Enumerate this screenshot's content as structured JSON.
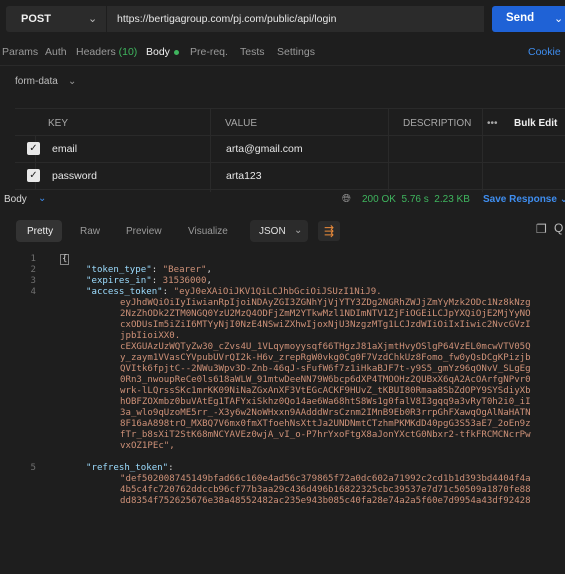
{
  "request": {
    "method": "POST",
    "url": "https://bertigagroup.com/pj.com/public/api/login",
    "send_label": "Send"
  },
  "request_tabs": {
    "params": "Params",
    "auth": "Auth",
    "headers": "Headers",
    "headers_count": "(10)",
    "body": "Body",
    "prereq": "Pre-req.",
    "tests": "Tests",
    "settings": "Settings",
    "cookies": "Cookie"
  },
  "body_mode": "form-data",
  "params_table": {
    "headers": {
      "key": "KEY",
      "value": "VALUE",
      "description": "DESCRIPTION",
      "more": "•••",
      "bulk_edit": "Bulk Edit"
    },
    "rows": [
      {
        "key": "email",
        "value": "arta@gmail.com"
      },
      {
        "key": "password",
        "value": "arta123"
      }
    ]
  },
  "response": {
    "body_tab": "Body",
    "status": "200 OK",
    "time": "5.76 s",
    "size": "2.23 KB",
    "save_label": "Save Response",
    "view_tabs": {
      "pretty": "Pretty",
      "raw": "Raw",
      "preview": "Preview",
      "visualize": "Visualize"
    },
    "format": "JSON"
  },
  "code": {
    "l1": "{",
    "l2_key": "\"token_type\"",
    "l2_val": "\"Bearer\"",
    "l3_key": "\"expires_in\"",
    "l3_val": "31536000",
    "l4_key": "\"access_token\"",
    "l4_val": "\"eyJ0eXAiOiJKV1QiLCJhbGciOiJSUzI1NiJ9.",
    "access_cont": [
      "eyJhdWQiOiIyIiwianRpIjoiNDAyZGI3ZGNhYjVjYTY3ZDg2NGRhZWJjZmYyMzk2ODc1Nz8kNzg",
      "2NzZhODk2ZTM0NGQ0YzU2MzQ4ODFjZmM2YTkwMzl1NDImNTV1ZjFiOGEiLCJpYXQiOjE2MjYyNO",
      "cxODUsIm5iZiI6MTYyNjI0NzE4NSwiZXhwIjoxNjU3NzgzMTg1LCJzdWIiOiIxIiwic2NvcGVzI",
      "jpbIioiXX0.",
      "cEXGUAzUzWQTyZw30_cZvs4U_1VLqymoyysqf66THgzJ81aXjmtHvyOSlgP64VzEL0mcwVTV05Q",
      "y_zaym1VVasCYVpubUVrQI2k-H6v_zrepRgW0vkg0Cg0F7VzdChkUz8Fomo_fw0yQsDCgKPizjb",
      "QVItk6fpjtC--2NWu3Wpv3D-Znb-46qJ-sFufW6f7z1iHkaBJF7t-y9S5_gmYz96qONvV_SLgEg",
      "0Rn3_nwoupReCe0ls618aWLW_91mtwDeeNN79W6bcp6dXP4TMOOHz2QUBxX6qA2AcOArfgNPvr0",
      "wrk-lLQrssSKc1mrKK09NiNaZGxAnXF3VtEGcACKF9HUvZ_tKBUI80Rmaa8SbZdOPY9SYSdiyXb",
      "hOBFZOXmbz0buVAtEg1TAFYxiSkhz0Qo14ae6Wa68htS8Ws1g0falV8I3gqq9a3vRyT0h2i0_iI",
      "3a_wlo9qUzoME5rr_-X3y6w2NoWHxxn9AAdddWrsCznm2IMnB9Eb0R3rrpGhFXawqOgAlNaHATN",
      "8F16aA898trO_MXBQ7V6mx0fmXTfoehNsXttJa2UNDNmtCTzhmPKMKdD40pgG3S53aE7_2oEn9z",
      "fTr_b8sXiT2StK68mNCYAVEz0wjA_vI_o-P7hrYxoFtgX8aJonYXctG0Nbxr2-tfkFRCMCNcrPw",
      "vxOZ1PEc\","
    ],
    "l5_key": "\"refresh_token\"",
    "refresh_cont": [
      "\"def502008745149bfad66c160e4ad56c379865f72a0dc602a71992c2cd1b1d393bd4404f4a",
      "4b5c4fc720762ddccb96cf77b3aa29c436d496b16822325cbc39537e7d71c50509a1870fe88",
      "dd8354f752625676e38a48552482ac235e943b085c40fa28e74a2a5f60e7d9954a43df92428"
    ],
    "line_numbers": [
      "1",
      "2",
      "3",
      "4",
      "5"
    ]
  }
}
